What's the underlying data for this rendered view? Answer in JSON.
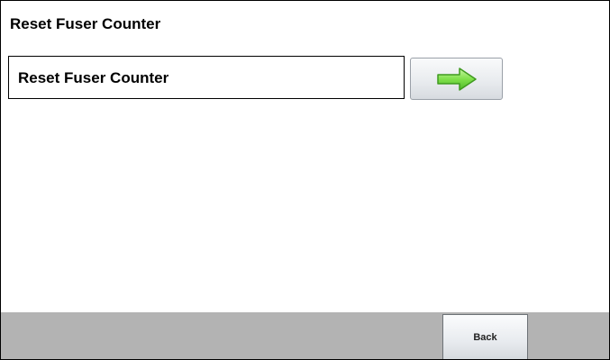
{
  "page": {
    "title": "Reset Fuser Counter"
  },
  "items": [
    {
      "label": "Reset Fuser Counter",
      "action_icon": "arrow-right-icon"
    }
  ],
  "footer": {
    "back_label": "Back"
  },
  "colors": {
    "footer_background": "#b3b3b3",
    "arrow_fill": "#7fe04a",
    "arrow_stroke": "#3f9a1f",
    "border": "#000000"
  }
}
